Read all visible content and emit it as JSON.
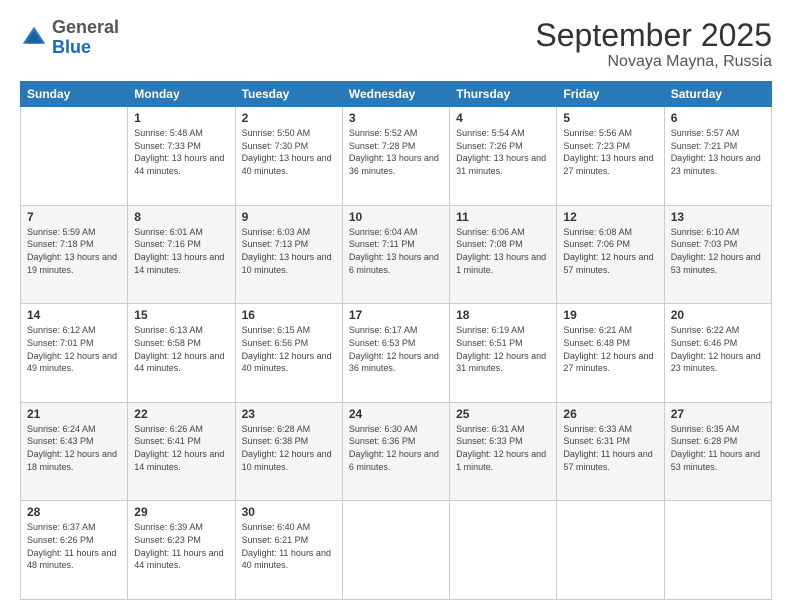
{
  "header": {
    "logo_general": "General",
    "logo_blue": "Blue",
    "month_title": "September 2025",
    "subtitle": "Novaya Mayna, Russia"
  },
  "days_of_week": [
    "Sunday",
    "Monday",
    "Tuesday",
    "Wednesday",
    "Thursday",
    "Friday",
    "Saturday"
  ],
  "weeks": [
    [
      {
        "day": "",
        "info": ""
      },
      {
        "day": "1",
        "info": "Sunrise: 5:48 AM\nSunset: 7:33 PM\nDaylight: 13 hours and 44 minutes."
      },
      {
        "day": "2",
        "info": "Sunrise: 5:50 AM\nSunset: 7:30 PM\nDaylight: 13 hours and 40 minutes."
      },
      {
        "day": "3",
        "info": "Sunrise: 5:52 AM\nSunset: 7:28 PM\nDaylight: 13 hours and 36 minutes."
      },
      {
        "day": "4",
        "info": "Sunrise: 5:54 AM\nSunset: 7:26 PM\nDaylight: 13 hours and 31 minutes."
      },
      {
        "day": "5",
        "info": "Sunrise: 5:56 AM\nSunset: 7:23 PM\nDaylight: 13 hours and 27 minutes."
      },
      {
        "day": "6",
        "info": "Sunrise: 5:57 AM\nSunset: 7:21 PM\nDaylight: 13 hours and 23 minutes."
      }
    ],
    [
      {
        "day": "7",
        "info": "Sunrise: 5:59 AM\nSunset: 7:18 PM\nDaylight: 13 hours and 19 minutes."
      },
      {
        "day": "8",
        "info": "Sunrise: 6:01 AM\nSunset: 7:16 PM\nDaylight: 13 hours and 14 minutes."
      },
      {
        "day": "9",
        "info": "Sunrise: 6:03 AM\nSunset: 7:13 PM\nDaylight: 13 hours and 10 minutes."
      },
      {
        "day": "10",
        "info": "Sunrise: 6:04 AM\nSunset: 7:11 PM\nDaylight: 13 hours and 6 minutes."
      },
      {
        "day": "11",
        "info": "Sunrise: 6:06 AM\nSunset: 7:08 PM\nDaylight: 13 hours and 1 minute."
      },
      {
        "day": "12",
        "info": "Sunrise: 6:08 AM\nSunset: 7:06 PM\nDaylight: 12 hours and 57 minutes."
      },
      {
        "day": "13",
        "info": "Sunrise: 6:10 AM\nSunset: 7:03 PM\nDaylight: 12 hours and 53 minutes."
      }
    ],
    [
      {
        "day": "14",
        "info": "Sunrise: 6:12 AM\nSunset: 7:01 PM\nDaylight: 12 hours and 49 minutes."
      },
      {
        "day": "15",
        "info": "Sunrise: 6:13 AM\nSunset: 6:58 PM\nDaylight: 12 hours and 44 minutes."
      },
      {
        "day": "16",
        "info": "Sunrise: 6:15 AM\nSunset: 6:56 PM\nDaylight: 12 hours and 40 minutes."
      },
      {
        "day": "17",
        "info": "Sunrise: 6:17 AM\nSunset: 6:53 PM\nDaylight: 12 hours and 36 minutes."
      },
      {
        "day": "18",
        "info": "Sunrise: 6:19 AM\nSunset: 6:51 PM\nDaylight: 12 hours and 31 minutes."
      },
      {
        "day": "19",
        "info": "Sunrise: 6:21 AM\nSunset: 6:48 PM\nDaylight: 12 hours and 27 minutes."
      },
      {
        "day": "20",
        "info": "Sunrise: 6:22 AM\nSunset: 6:46 PM\nDaylight: 12 hours and 23 minutes."
      }
    ],
    [
      {
        "day": "21",
        "info": "Sunrise: 6:24 AM\nSunset: 6:43 PM\nDaylight: 12 hours and 18 minutes."
      },
      {
        "day": "22",
        "info": "Sunrise: 6:26 AM\nSunset: 6:41 PM\nDaylight: 12 hours and 14 minutes."
      },
      {
        "day": "23",
        "info": "Sunrise: 6:28 AM\nSunset: 6:38 PM\nDaylight: 12 hours and 10 minutes."
      },
      {
        "day": "24",
        "info": "Sunrise: 6:30 AM\nSunset: 6:36 PM\nDaylight: 12 hours and 6 minutes."
      },
      {
        "day": "25",
        "info": "Sunrise: 6:31 AM\nSunset: 6:33 PM\nDaylight: 12 hours and 1 minute."
      },
      {
        "day": "26",
        "info": "Sunrise: 6:33 AM\nSunset: 6:31 PM\nDaylight: 11 hours and 57 minutes."
      },
      {
        "day": "27",
        "info": "Sunrise: 6:35 AM\nSunset: 6:28 PM\nDaylight: 11 hours and 53 minutes."
      }
    ],
    [
      {
        "day": "28",
        "info": "Sunrise: 6:37 AM\nSunset: 6:26 PM\nDaylight: 11 hours and 48 minutes."
      },
      {
        "day": "29",
        "info": "Sunrise: 6:39 AM\nSunset: 6:23 PM\nDaylight: 11 hours and 44 minutes."
      },
      {
        "day": "30",
        "info": "Sunrise: 6:40 AM\nSunset: 6:21 PM\nDaylight: 11 hours and 40 minutes."
      },
      {
        "day": "",
        "info": ""
      },
      {
        "day": "",
        "info": ""
      },
      {
        "day": "",
        "info": ""
      },
      {
        "day": "",
        "info": ""
      }
    ]
  ]
}
